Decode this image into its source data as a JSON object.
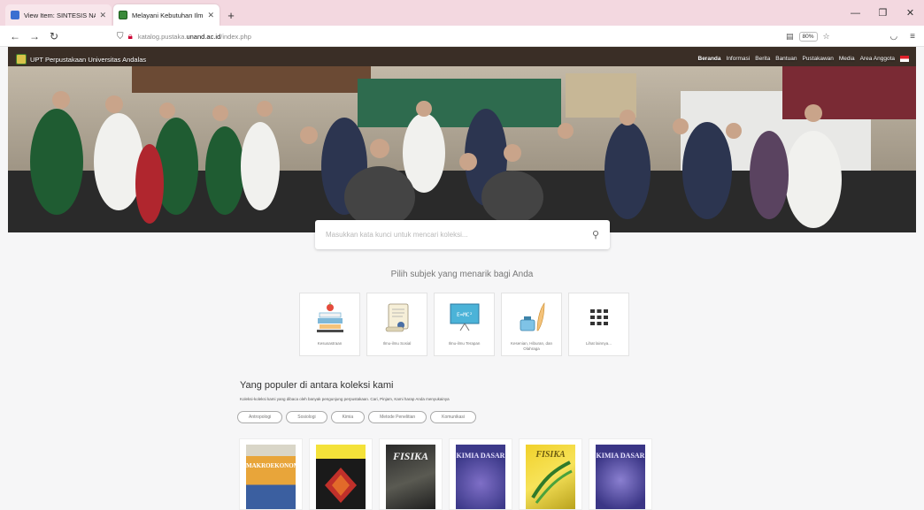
{
  "browser": {
    "tabs": [
      {
        "title": "View Item: SINTESIS NANOKOM",
        "active": false
      },
      {
        "title": "Melayani Kebutuhan Ilmu deng",
        "active": true
      }
    ],
    "url_prefix": "katalog.pustaka.",
    "url_domain": "unand.ac.id",
    "url_path": "/index.php",
    "zoom": "80%"
  },
  "site": {
    "name": "UPT Perpustakaan Universitas Andalas",
    "nav": [
      "Beranda",
      "Informasi",
      "Berita",
      "Bantuan",
      "Pustakawan",
      "Media",
      "Area Anggota"
    ]
  },
  "search": {
    "placeholder": "Masukkan kata kunci untuk mencari koleksi..."
  },
  "subjects": {
    "heading": "Pilih subjek yang menarik bagi Anda",
    "items": [
      {
        "label": "Kesusastraan",
        "icon": "books-apple-icon"
      },
      {
        "label": "Ilmu-ilmu Sosial",
        "icon": "scroll-icon"
      },
      {
        "label": "Ilmu-ilmu Terapan",
        "icon": "blackboard-icon"
      },
      {
        "label": "Kesenian, Hiburan, dan Olahraga",
        "icon": "ink-feather-icon"
      },
      {
        "label": "Lihat lainnya...",
        "icon": "grid-icon"
      }
    ]
  },
  "popular": {
    "title": "Yang populer di antara koleksi kami",
    "description": "Koleksi-koleksi kami yang dibaca oleh banyak pengunjung perpustakaan. Cari, Pinjam, Kami harap Anda menyukainya",
    "tags": [
      "Antropologi",
      "Sosiologi",
      "Kimia",
      "Metode Penelitian",
      "Komunikasi"
    ],
    "books": [
      {
        "cover_text": "MAKROEKONOMI"
      },
      {
        "cover_text": ""
      },
      {
        "cover_text": "FISIKA"
      },
      {
        "cover_text": "KIMIA DASAR"
      },
      {
        "cover_text": "FISIKA"
      },
      {
        "cover_text": "KIMIA DASAR"
      }
    ]
  }
}
